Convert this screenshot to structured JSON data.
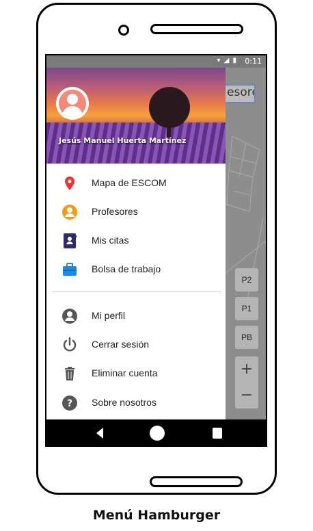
{
  "statusbar": {
    "time": "0:11",
    "icons": "▾ ◢ ▮"
  },
  "user": {
    "name": "Jesús Manuel Huerta Martínez"
  },
  "map": {
    "search_text": "esore",
    "floors": [
      "P2",
      "P1",
      "PB"
    ],
    "zoom_in": "+",
    "zoom_out": "−"
  },
  "menu": {
    "items": [
      {
        "label": "Mapa de ESCOM",
        "icon": "location-pin-icon",
        "color": "#e53935"
      },
      {
        "label": "Profesores",
        "icon": "person-circle-icon",
        "color": "#f39c12"
      },
      {
        "label": "Mis citas",
        "icon": "contacts-book-icon",
        "color": "#2e2a6e"
      },
      {
        "label": "Bolsa de trabajo",
        "icon": "briefcase-icon",
        "color": "#1e88e5"
      },
      {
        "label": "Mi perfil",
        "icon": "account-circle-icon",
        "color": "#555555"
      },
      {
        "label": "Cerrar sesión",
        "icon": "power-icon",
        "color": "#555555"
      },
      {
        "label": "Eliminar cuenta",
        "icon": "trash-icon",
        "color": "#555555"
      },
      {
        "label": "Sobre nosotros",
        "icon": "help-circle-icon",
        "color": "#555555"
      }
    ]
  },
  "caption": "Menú Hamburger"
}
